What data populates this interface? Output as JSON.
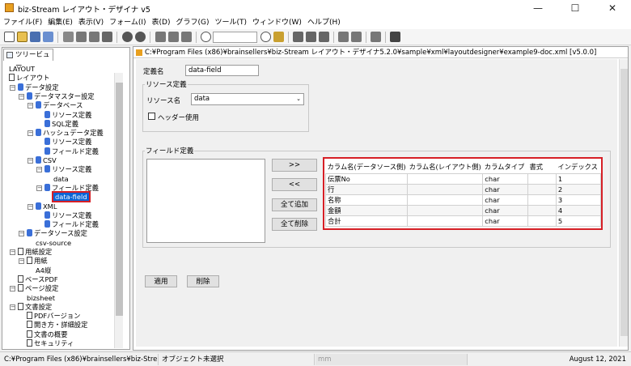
{
  "window": {
    "title": "biz-Stream レイアウト・デザイナ v5"
  },
  "menu": [
    "ファイル(F)",
    "編集(E)",
    "表示(V)",
    "フォーム(I)",
    "表(D)",
    "グラフ(G)",
    "ツール(T)",
    "ウィンドウ(W)",
    "ヘルプ(H)"
  ],
  "left_tab": "ツリービュー",
  "tree": [
    {
      "label": "LAYOUT",
      "depth": 0,
      "icon": "none"
    },
    {
      "label": "レイアウト",
      "depth": 0,
      "icon": "doc"
    },
    {
      "label": "データ設定",
      "depth": 1,
      "icon": "db"
    },
    {
      "label": "データマスター設定",
      "depth": 2,
      "icon": "db"
    },
    {
      "label": "データベース",
      "depth": 3,
      "icon": "db"
    },
    {
      "label": "リソース定義",
      "depth": 4,
      "icon": "db"
    },
    {
      "label": "SQL定義",
      "depth": 4,
      "icon": "db"
    },
    {
      "label": "ハッシュデータ定義",
      "depth": 3,
      "icon": "db"
    },
    {
      "label": "リソース定義",
      "depth": 4,
      "icon": "db"
    },
    {
      "label": "フィールド定義",
      "depth": 4,
      "icon": "db"
    },
    {
      "label": "CSV",
      "depth": 3,
      "icon": "db"
    },
    {
      "label": "リソース定義",
      "depth": 4,
      "icon": "db"
    },
    {
      "label": "data",
      "depth": 5,
      "icon": "none"
    },
    {
      "label": "フィールド定義",
      "depth": 4,
      "icon": "db"
    },
    {
      "label": "data-field",
      "depth": 5,
      "icon": "none"
    },
    {
      "label": "XML",
      "depth": 3,
      "icon": "db"
    },
    {
      "label": "リソース定義",
      "depth": 4,
      "icon": "db"
    },
    {
      "label": "フィールド定義",
      "depth": 4,
      "icon": "db"
    },
    {
      "label": "データソース設定",
      "depth": 2,
      "icon": "db"
    },
    {
      "label": "csv-source",
      "depth": 3,
      "icon": "none"
    },
    {
      "label": "用紙設定",
      "depth": 1,
      "icon": "doc"
    },
    {
      "label": "用紙",
      "depth": 2,
      "icon": "doc"
    },
    {
      "label": "A4縦",
      "depth": 3,
      "icon": "none"
    },
    {
      "label": "ベースPDF",
      "depth": 1,
      "icon": "doc"
    },
    {
      "label": "ページ設定",
      "depth": 1,
      "icon": "doc"
    },
    {
      "label": "bizsheet",
      "depth": 2,
      "icon": "none"
    },
    {
      "label": "文書設定",
      "depth": 1,
      "icon": "doc"
    },
    {
      "label": "PDFバージョン",
      "depth": 2,
      "icon": "doc"
    },
    {
      "label": "開き方・詳細設定",
      "depth": 2,
      "icon": "doc"
    },
    {
      "label": "文書の概要",
      "depth": 2,
      "icon": "doc"
    },
    {
      "label": "セキュリティ",
      "depth": 2,
      "icon": "doc"
    }
  ],
  "document": {
    "title": "C:¥Program Files (x86)¥brainsellers¥biz-Stream レイアウト・デザイナ5.2.0¥sample¥xml¥layoutdesigner¥example9-doc.xml [v5.0.0]"
  },
  "form": {
    "def_name_label": "定義名",
    "def_name_value": "data-field",
    "resource_group": "リソース定義",
    "resource_name_label": "リソース名",
    "resource_name_value": "data",
    "header_checkbox_label": "ヘッダー使用",
    "field_group": "フィールド定義",
    "btn_add": ">>",
    "btn_remove": "<<",
    "btn_add_all": "全て追加",
    "btn_remove_all": "全て削除",
    "btn_apply": "適用",
    "btn_delete": "削除"
  },
  "grid": {
    "headers": [
      "カラム名(データソース側)",
      "カラム名(レイアウト側)",
      "カラムタイプ",
      "書式",
      "インデックス"
    ],
    "rows": [
      [
        "伝票No",
        "",
        "char",
        "",
        "1"
      ],
      [
        "行",
        "",
        "char",
        "",
        "2"
      ],
      [
        "名称",
        "",
        "char",
        "",
        "3"
      ],
      [
        "金額",
        "",
        "char",
        "",
        "4"
      ],
      [
        "合計",
        "",
        "char",
        "",
        "5"
      ]
    ]
  },
  "status": {
    "path": "C:¥Program Files (x86)¥brainsellers¥biz-Stre...",
    "selection": "オブジェクト未選択",
    "unit": "mm",
    "date": "August 12, 2021"
  },
  "colors": {
    "highlight": "#d61f26",
    "selected": "#0a64d6"
  }
}
